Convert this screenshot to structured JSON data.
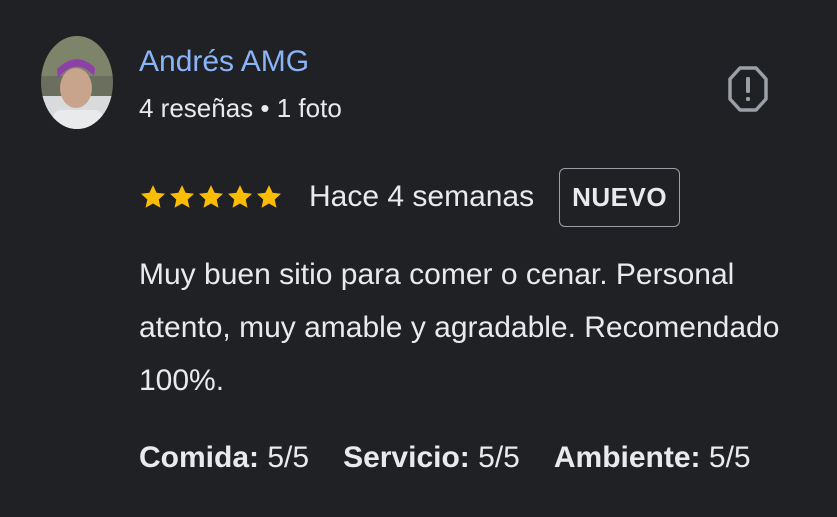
{
  "reviewer": {
    "name": "Andrés AMG",
    "stats": "4 reseñas • 1 foto"
  },
  "review": {
    "stars": 5,
    "date": "Hace 4 semanas",
    "badge": "NUEVO",
    "text": "Muy buen sitio para comer o cenar. Personal atento, muy amable y agradable. Recomendado 100%."
  },
  "attributes": [
    {
      "label": "Comida:",
      "value": "5/5"
    },
    {
      "label": "Servicio:",
      "value": "5/5"
    },
    {
      "label": "Ambiente:",
      "value": "5/5"
    }
  ],
  "colors": {
    "background": "#202124",
    "name": "#8ab4f8",
    "star": "#fbbc04",
    "text": "#e8eaed"
  },
  "icons": {
    "report": "report-flag-icon",
    "star": "star-icon"
  }
}
